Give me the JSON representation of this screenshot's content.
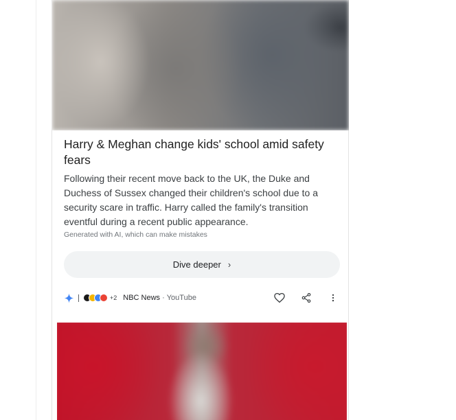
{
  "article": {
    "headline": "Harry & Meghan change kids' school amid safety fears",
    "summary": "Following their recent move back to the UK, the Duke and Duchess of Sussex changed their children's school due to a security scare in traffic. Harry called the family's transition eventful during a recent public appearance.",
    "disclaimer": "Generated with AI, which can make mistakes",
    "dive_button_label": "Dive deeper",
    "dive_button_chevron": "›"
  },
  "source": {
    "extra_count": "+2",
    "name": "NBC News",
    "separator": "·",
    "platform": "YouTube",
    "favicon_colors": [
      "#1a1a1a",
      "#f4b400",
      "#4285f4",
      "#ea4335"
    ]
  },
  "actions": {
    "like_icon": "heart-icon",
    "share_icon": "share-icon",
    "more_icon": "more-vert-icon"
  },
  "colors": {
    "sparkle_blue": "#4285f4",
    "button_bg": "#f1f3f4"
  }
}
